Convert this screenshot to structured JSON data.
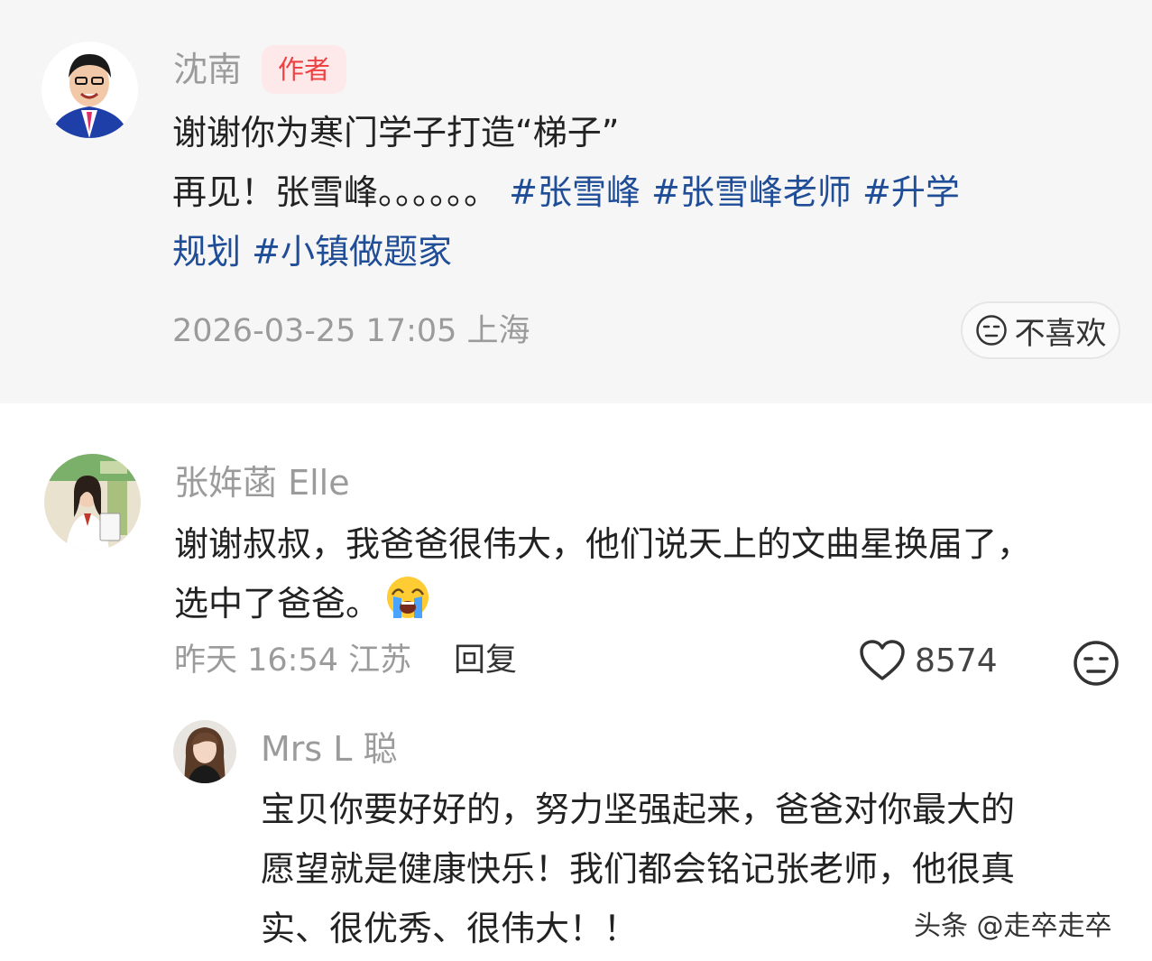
{
  "author_comment": {
    "name": "沈南",
    "badge": "作者",
    "line1": "谢谢你为寒门学子打造“梯子”",
    "line2_text": "再见！张雪峰。。。。。。",
    "tags": [
      "#张雪峰",
      "#张雪峰老师",
      "#升学规划",
      "#小镇做题家"
    ],
    "timestamp": "2026-03-25 17:05",
    "location": "上海",
    "dislike_label": "不喜欢",
    "dislike_icon": "meh-face-icon"
  },
  "comment": {
    "name": "张姩菡 Elle",
    "line1": "谢谢叔叔，我爸爸很伟大，他们说天上的文曲星换届了，",
    "line2": "选中了爸爸。",
    "emoji": "crying-face-emoji",
    "time": "昨天 16:54",
    "location": "江苏",
    "reply_label": "回复",
    "like_icon": "heart-icon",
    "like_count": "8574",
    "dislike_icon": "meh-face-icon"
  },
  "reply": {
    "name": "Mrs L 聪",
    "line1": "宝贝你要好好的，努力坚强起来，爸爸对你最大的",
    "line2": "愿望就是健康快乐！我们都会铭记张老师，他很真",
    "line3": "实、很优秀、很伟大！！"
  },
  "watermark": "头条 @走卒走卒",
  "colors": {
    "card_bg": "#f6f6f6",
    "badge_bg": "#fde9ea",
    "badge_text": "#f04142",
    "tag": "#1f4d97",
    "meta": "#9b9b9b"
  }
}
